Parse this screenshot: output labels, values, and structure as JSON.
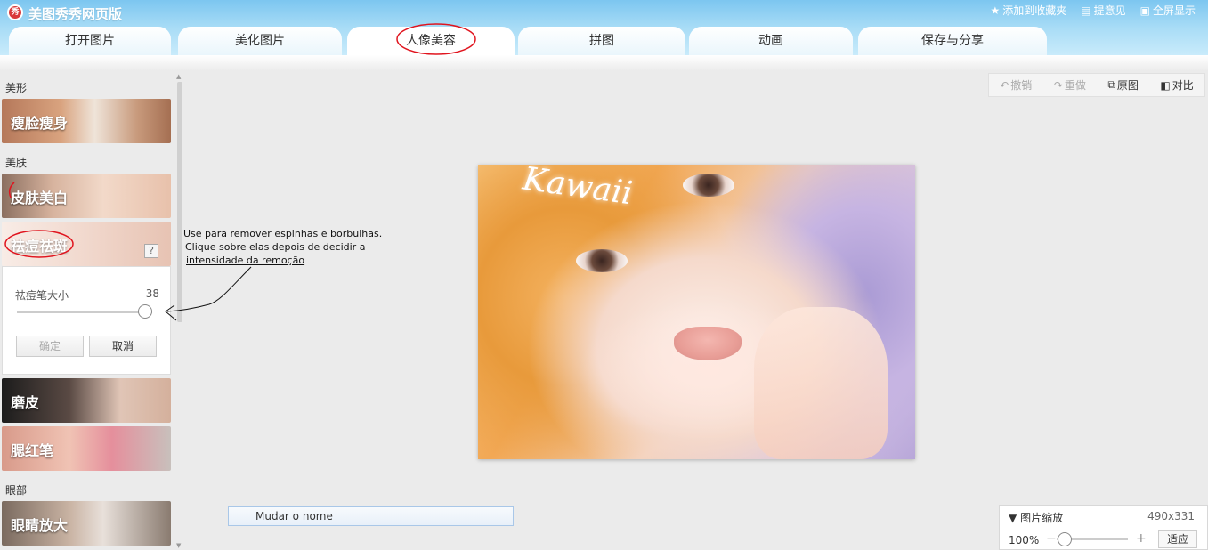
{
  "app": {
    "logo": "秀",
    "title": "美图秀秀网页版"
  },
  "toplinks": [
    {
      "icon": "★",
      "label": "添加到收藏夹"
    },
    {
      "icon": "▤",
      "label": "提意见"
    },
    {
      "icon": "▣",
      "label": "全屏显示"
    }
  ],
  "tabs": [
    "打开图片",
    "美化图片",
    "人像美容",
    "拼图",
    "动画",
    "保存与分享"
  ],
  "active_tab": "人像美容",
  "sections": {
    "shape": "美形",
    "skin": "美肤",
    "eyes": "眼部"
  },
  "features": {
    "face": "瘦脸瘦身",
    "white": "皮肤美白",
    "acne": "祛痘祛斑",
    "smooth": "磨皮",
    "blush": "腮红笔",
    "eye": "眼睛放大"
  },
  "help": "?",
  "brush_panel": {
    "label": "祛痘笔大小",
    "value": "38",
    "level": 0.95,
    "confirm": "确定",
    "cancel": "取消"
  },
  "annotation": {
    "line1": "Use para remover espinhas e borbulhas.",
    "line2": "Clique sobre elas depois de decidir a",
    "line3": "intensidade da remoção"
  },
  "toolbar": {
    "undo": "撤销",
    "redo": "重做",
    "original": "原图",
    "compare": "对比"
  },
  "photo": {
    "text": "Kawaii"
  },
  "rename": "Mudar o nome",
  "zoom": {
    "title": "图片缩放",
    "dims": "490x331",
    "percent": "100%",
    "minus": "−",
    "plus": "+",
    "fit": "适应",
    "level": 0.05
  },
  "colors": {
    "accent": "#7cc6f0",
    "markup_red": "#e0141e"
  }
}
